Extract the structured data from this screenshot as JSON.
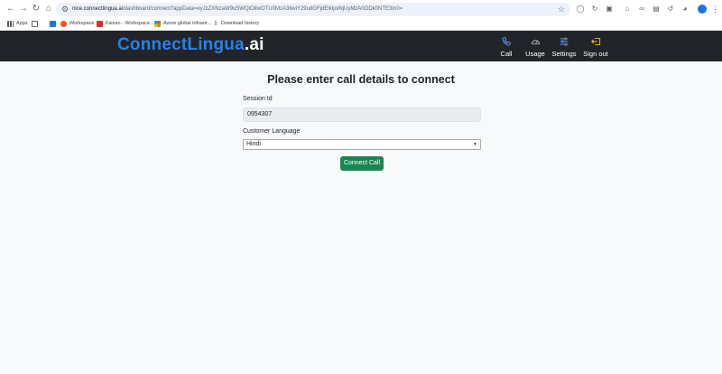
{
  "browser": {
    "url_host": "nice.connectlingua.ai",
    "url_path": "/dashboard/connect?appData=eyJzZXNzaW9uSWQiOiIwOTU0MzA3IiwiY29udGFjdElkIjoiNjUyMzA0ODk0NTE3In0=",
    "bookmarks": [
      {
        "label": "Apps",
        "icon": "apps-grid-icon",
        "color": "#5f6368"
      },
      {
        "label": "",
        "icon": "bookmark-folder-icon",
        "color": "#5f6368"
      },
      {
        "label": "",
        "icon": "bookmark-icon",
        "color": "#1a73e8"
      },
      {
        "label": "Workspace",
        "icon": "workspace-icon",
        "color": "#f4511e"
      },
      {
        "label": "Faizan - Workspace...",
        "icon": "faizan-workspace-icon",
        "color": "#d93025"
      },
      {
        "label": "Azure global infrastr...",
        "icon": "azure-icon",
        "color": "#0078d4"
      },
      {
        "label": "Download history",
        "icon": "download-icon",
        "color": "#3c4043"
      }
    ]
  },
  "app": {
    "brand": "ConnectLingua",
    "brand_suffix": ".ai",
    "nav": [
      {
        "label": "Call",
        "icon": "phone-icon",
        "color": "#6ea8fe"
      },
      {
        "label": "Usage",
        "icon": "gauge-icon",
        "color": "#adb5bd"
      },
      {
        "label": "Settings",
        "icon": "sliders-icon",
        "color": "#6ea8fe"
      },
      {
        "label": "Sign out",
        "icon": "sign-out-icon",
        "color": "#ffc107"
      }
    ]
  },
  "form": {
    "title": "Please enter call details to connect",
    "session_label": "Session Id",
    "session_value": "0954307",
    "language_label": "Customer Language",
    "language_value": "Hindi",
    "submit_label": "Connect Call"
  }
}
